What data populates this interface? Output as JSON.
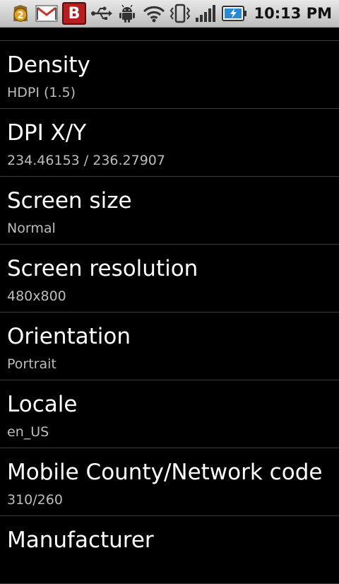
{
  "status_bar": {
    "notification_count": "2",
    "b_app_label": "B",
    "time": "10:13 PM",
    "icons": [
      "notification-count-icon",
      "gmail-icon",
      "b-app-icon",
      "usb-icon",
      "android-debug-icon",
      "wifi-icon",
      "vibrate-icon",
      "signal-icon",
      "battery-charging-icon"
    ]
  },
  "items": [
    {
      "title": "Density",
      "value": "HDPI (1.5)"
    },
    {
      "title": "DPI X/Y",
      "value": "234.46153 / 236.27907"
    },
    {
      "title": "Screen size",
      "value": "Normal"
    },
    {
      "title": "Screen resolution",
      "value": "480x800"
    },
    {
      "title": "Orientation",
      "value": "Portrait"
    },
    {
      "title": "Locale",
      "value": "en_US"
    },
    {
      "title": "Mobile County/Network code",
      "value": "310/260"
    },
    {
      "title": "Manufacturer",
      "value": ""
    }
  ]
}
